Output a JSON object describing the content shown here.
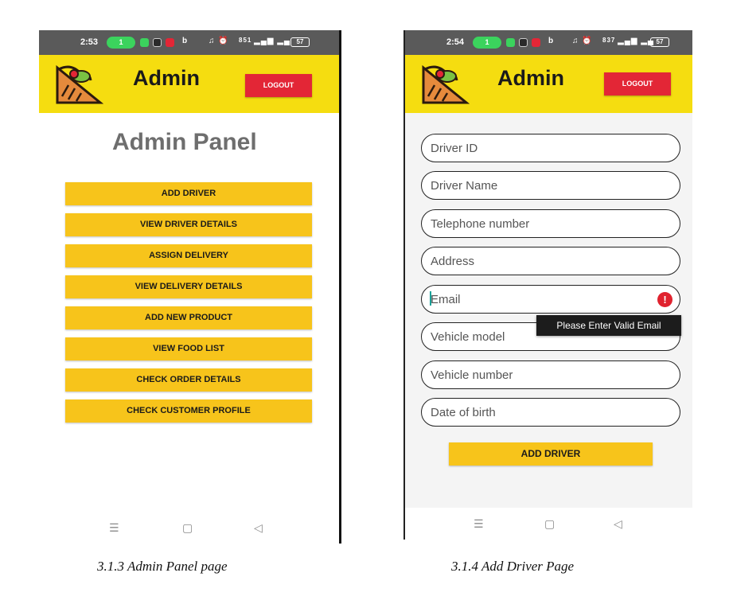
{
  "left_screen": {
    "status": {
      "time": "2:53",
      "pill": "1",
      "right_text": "851",
      "battery": "57"
    },
    "app_title": "Admin",
    "logout_label": "LOGOUT",
    "panel_title": "Admin Panel",
    "menu": [
      "ADD DRIVER",
      "VIEW DRIVER DETAILS",
      "ASSIGN DELIVERY",
      "VIEW DELIVERY DETAILS",
      "ADD NEW PRODUCT",
      "VIEW FOOD LIST",
      "CHECK ORDER DETAILS",
      "CHECK CUSTOMER PROFILE"
    ]
  },
  "right_screen": {
    "status": {
      "time": "2:54",
      "pill": "1",
      "right_text": "837",
      "battery": "57"
    },
    "app_title": "Admin",
    "logout_label": "LOGOUT",
    "fields": [
      "Driver ID",
      "Driver Name",
      "Telephone number",
      "Address",
      "Email",
      "Vehicle model",
      "Vehicle number",
      "Date of birth"
    ],
    "error_tooltip": "Please Enter Valid Email",
    "submit_label": "ADD DRIVER"
  },
  "nav_icons": [
    "menu-icon",
    "home-icon",
    "back-icon"
  ],
  "captions": {
    "left": "3.1.3  Admin Panel page",
    "right": "3.1.4 Add Driver Page"
  },
  "colors": {
    "appbar": "#f5dd10",
    "button": "#f7c41b",
    "logout": "#e32636",
    "error": "#e0222e"
  }
}
